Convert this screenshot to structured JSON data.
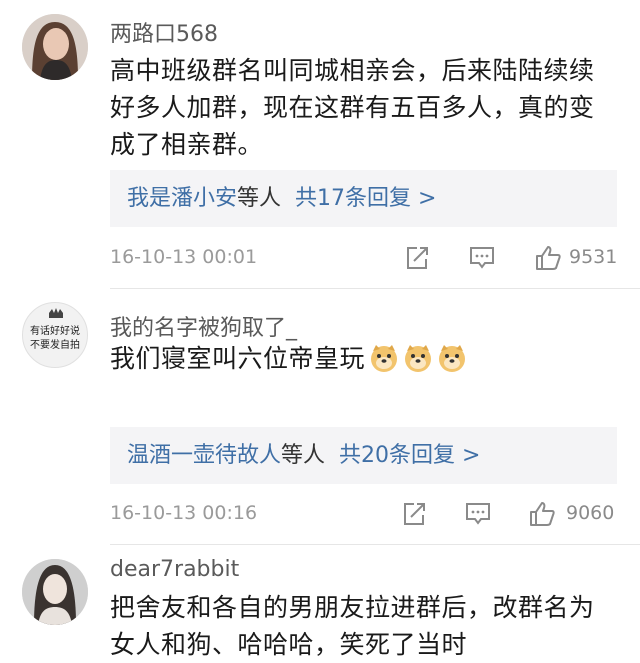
{
  "comments": [
    {
      "username": "两路口568",
      "text": "高中班级群名叫同城相亲会，后来陆陆续续好多人加群，现在这群有五百多人，真的变成了相亲群。",
      "reply_users": "我是潘小安",
      "reply_mid": "等人",
      "reply_count": "共17条回复 >",
      "timestamp": "16-10-13 00:01",
      "likes": "9531"
    },
    {
      "username": "我的名字被狗取了_",
      "text": "我们寝室叫六位帝皇玩",
      "avatar_text_line1": "有话好好说",
      "avatar_text_line2": "不要发自拍",
      "reply_users": "温酒一壶待故人",
      "reply_mid": "等人",
      "reply_count": "共20条回复 >",
      "timestamp": "16-10-13 00:16",
      "likes": "9060"
    },
    {
      "username": "dear7rabbit",
      "text": "把舍友和各自的男朋友拉进群后，改群名为女人和狗、哈哈哈，笑死了当时"
    }
  ],
  "icons": {
    "share": "share-icon",
    "comment": "comment-icon",
    "like": "thumbs-up-icon",
    "emoji": "doge-emoji-icon"
  },
  "colors": {
    "link": "#3f6fa6",
    "reply_bg": "#f4f4f6",
    "meta": "#9a9a9a"
  }
}
